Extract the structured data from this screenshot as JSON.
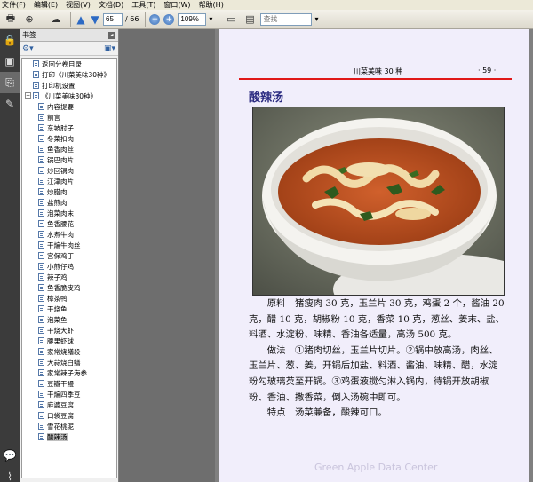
{
  "menu": [
    "文件(F)",
    "编辑(E)",
    "视图(V)",
    "文档(D)",
    "工具(T)",
    "窗口(W)",
    "帮助(H)"
  ],
  "toolbar": {
    "page_current": "65",
    "page_total": "/ 66",
    "zoom": "109%",
    "search_placeholder": "查找"
  },
  "panel": {
    "title": "书签"
  },
  "bookmarks": [
    {
      "label": "返回分卷目录",
      "level": 0
    },
    {
      "label": "打印《川菜美味30种》",
      "level": 0
    },
    {
      "label": "打印机设置",
      "level": 0
    },
    {
      "label": "《川菜美味30种》",
      "level": 0,
      "expanded": true
    },
    {
      "label": "内容提要",
      "level": 1
    },
    {
      "label": "前言",
      "level": 1
    },
    {
      "label": "东坡肘子",
      "level": 1
    },
    {
      "label": "冬菜扣肉",
      "level": 1
    },
    {
      "label": "鱼香肉丝",
      "level": 1
    },
    {
      "label": "锅巴肉片",
      "level": 1
    },
    {
      "label": "炒回锅肉",
      "level": 1
    },
    {
      "label": "江津肉片",
      "level": 1
    },
    {
      "label": "炒腊肉",
      "level": 1
    },
    {
      "label": "盐煎肉",
      "level": 1
    },
    {
      "label": "泡菜肉末",
      "level": 1
    },
    {
      "label": "鱼香腰花",
      "level": 1
    },
    {
      "label": "水煮牛肉",
      "level": 1
    },
    {
      "label": "干煸牛肉丝",
      "level": 1
    },
    {
      "label": "宫保鸡丁",
      "level": 1
    },
    {
      "label": "小煎仔鸡",
      "level": 1
    },
    {
      "label": "辣子鸡",
      "level": 1
    },
    {
      "label": "鱼香脆皮鸡",
      "level": 1
    },
    {
      "label": "樟茶鸭",
      "level": 1
    },
    {
      "label": "干烧鱼",
      "level": 1
    },
    {
      "label": "泡菜鱼",
      "level": 1
    },
    {
      "label": "干烧大虾",
      "level": 1
    },
    {
      "label": "腰果虾球",
      "level": 1
    },
    {
      "label": "家常烧鳝段",
      "level": 1
    },
    {
      "label": "大蒜烧白鳝",
      "level": 1
    },
    {
      "label": "家常辣子海参",
      "level": 1
    },
    {
      "label": "豆瓣干鳗",
      "level": 1
    },
    {
      "label": "干煸四季豆",
      "level": 1
    },
    {
      "label": "麻婆豆腐",
      "level": 1
    },
    {
      "label": "口袋豆腐",
      "level": 1
    },
    {
      "label": "雪花桃泥",
      "level": 1
    },
    {
      "label": "酸辣汤",
      "level": 1,
      "selected": true
    }
  ],
  "page": {
    "header_title": "川菜美味 30 种",
    "page_number": "· 59 ·",
    "chapter_title": "酸辣汤",
    "paragraphs": [
      "原料　猪瘦肉 30 克，玉兰片 30 克，鸡蛋 2 个，酱油 20 克，醋 10 克，胡椒粉 10 克，香菜 10 克，葱丝、姜末、盐、料酒、水淀粉、味精、香油各适量，高汤 500 克。",
      "做法　①猪肉切丝，玉兰片切片。②锅中放高汤，肉丝、玉兰片、葱、姜，开锅后加盐、料酒、酱油、味精、醋，水淀粉勾玻璃芡至开锅。③鸡蛋液搅匀淋入锅内，待锅开放胡椒粉、香油、撒香菜，倒入汤碗中即可。",
      "特点　汤菜兼备，酸辣可口。"
    ],
    "watermark": "Green Apple Data Center"
  }
}
